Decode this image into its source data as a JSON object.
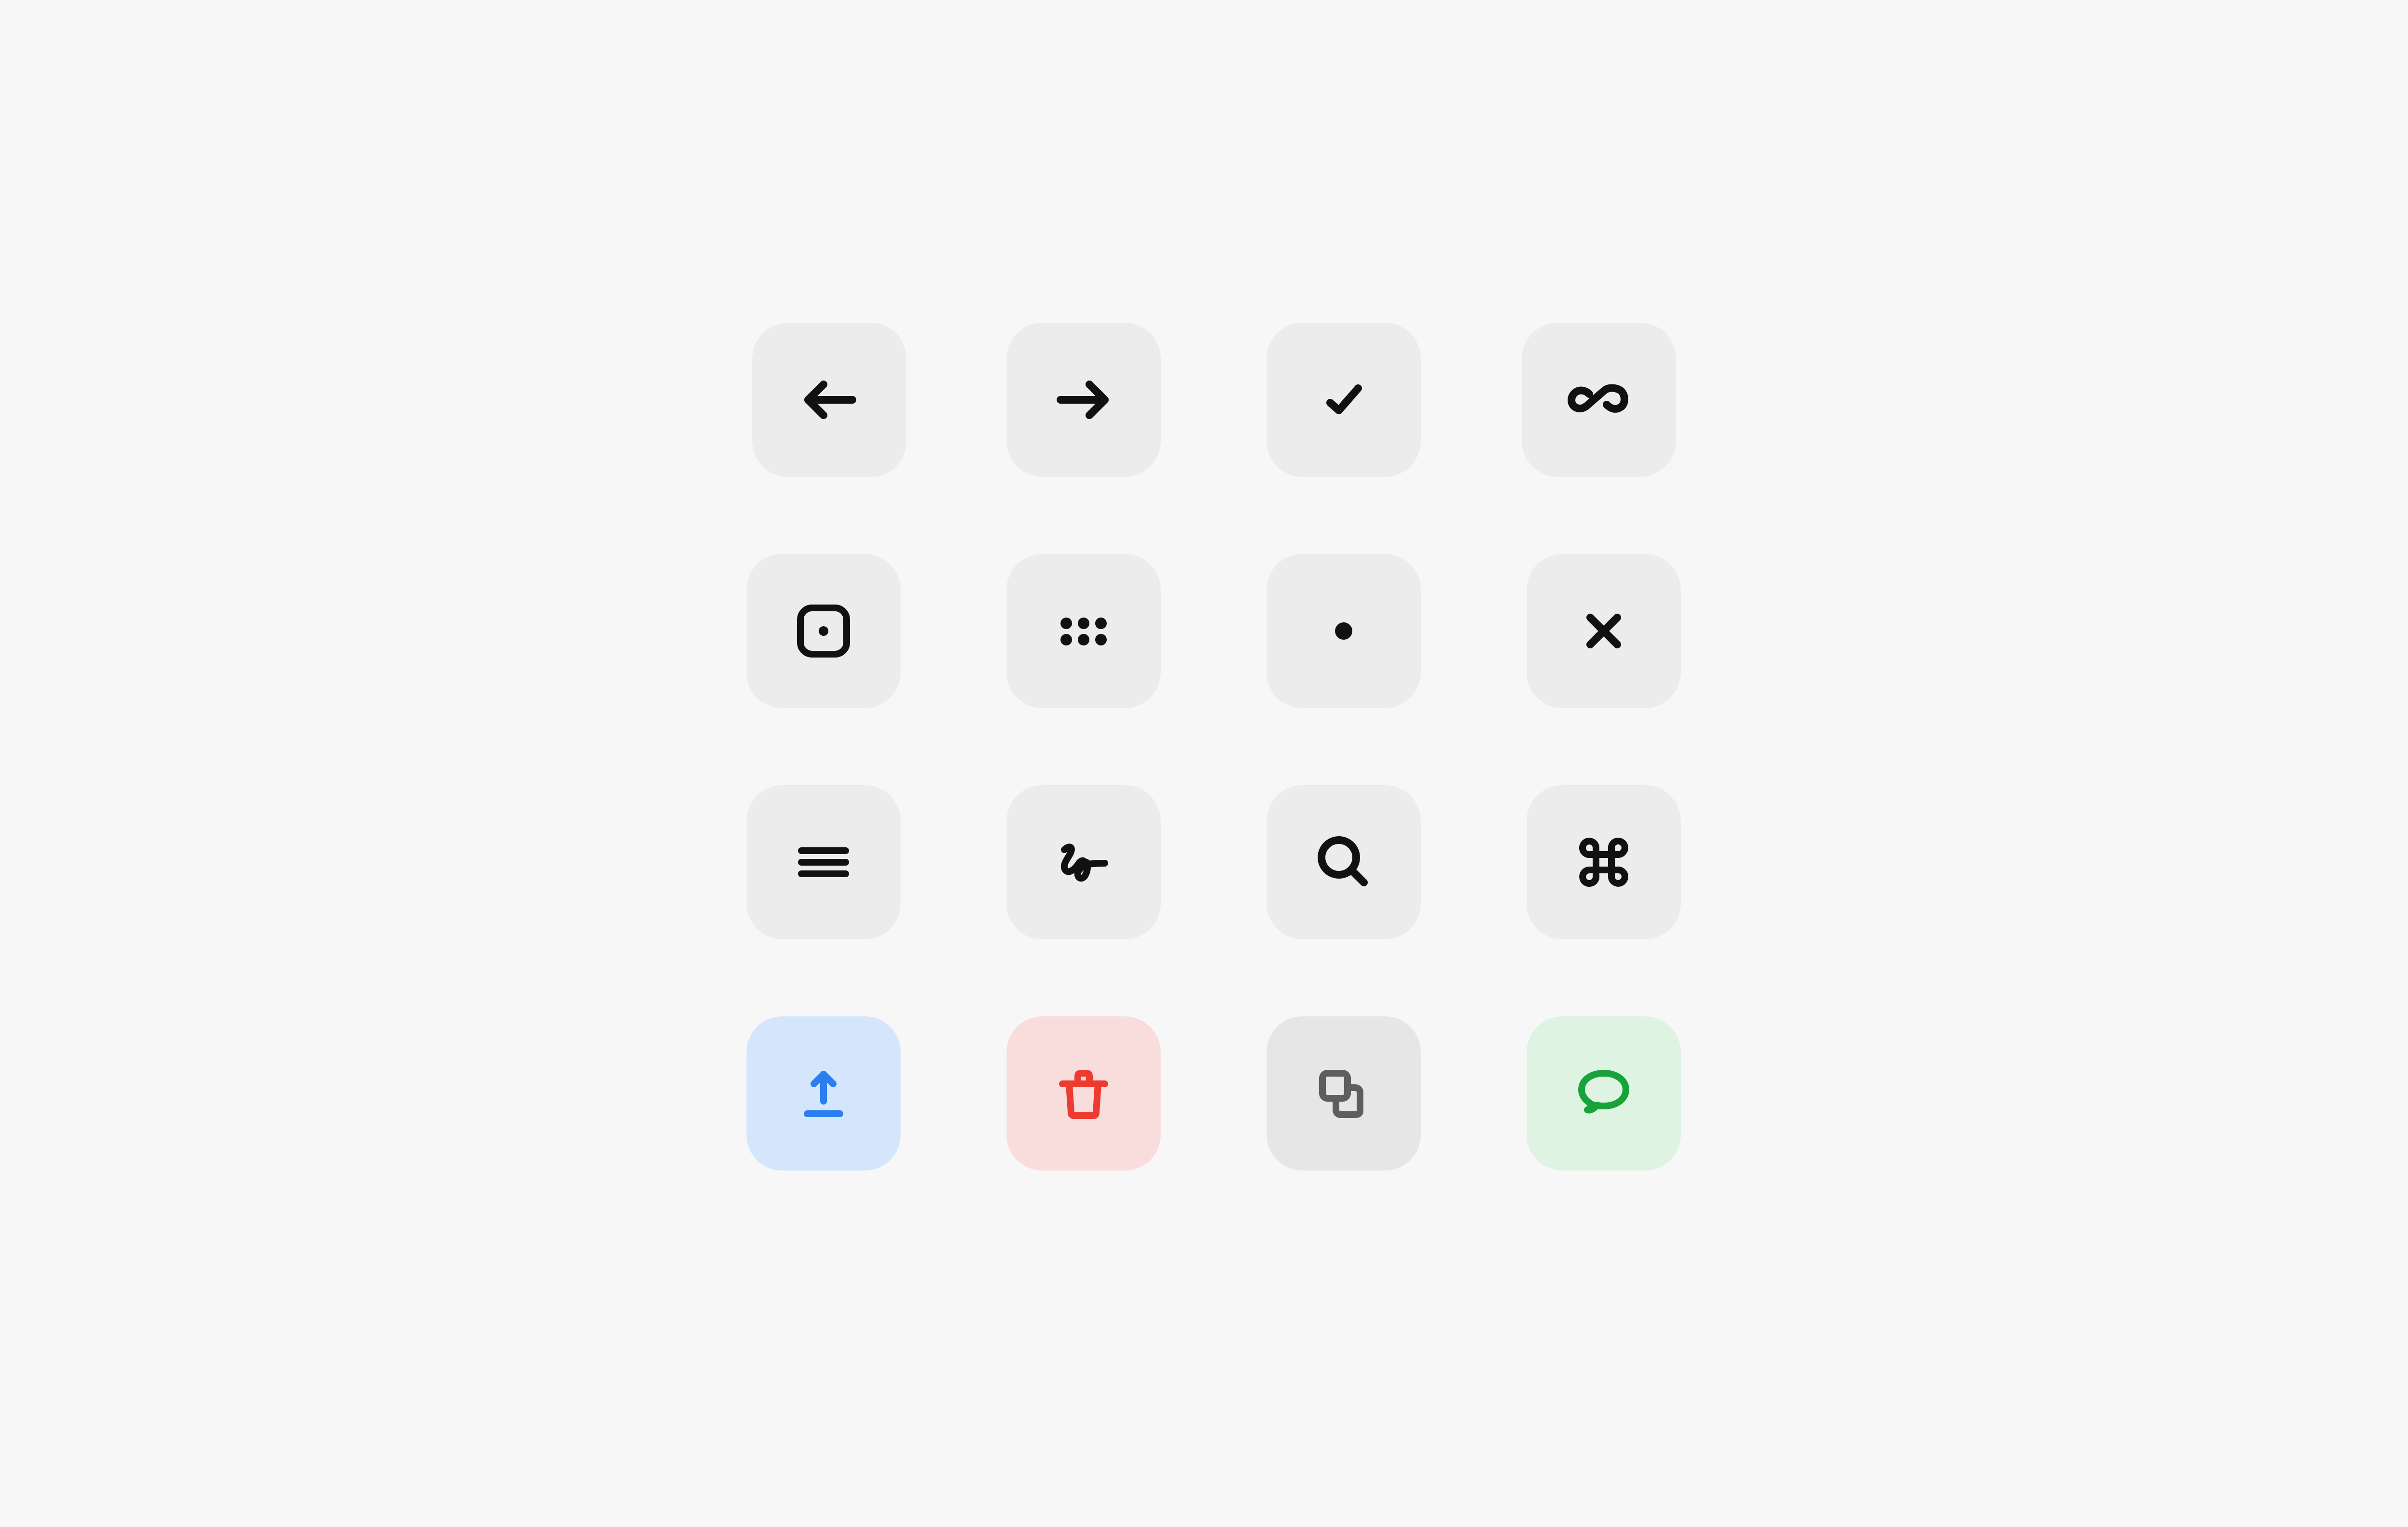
{
  "page": {
    "background": "#f7f7f7"
  },
  "colors": {
    "tile_neutral": "#ececec",
    "tile_blue": "#d3e6fb",
    "tile_red": "#f9dcdc",
    "tile_gray": "#e6e6e6",
    "tile_green": "#dff3e3",
    "icon_black": "#111111",
    "icon_blue": "#2c7ef0",
    "icon_red": "#ee3b30",
    "icon_gray": "#5e5e5e",
    "icon_green": "#17a33a"
  },
  "icon_grid": {
    "rows": [
      [
        {
          "icon": "arrow-left-icon",
          "variant": "neutral"
        },
        {
          "icon": "arrow-right-icon",
          "variant": "neutral"
        },
        {
          "icon": "checkmark-icon",
          "variant": "neutral"
        },
        {
          "icon": "infinity-link-icon",
          "variant": "neutral"
        }
      ],
      [
        {
          "icon": "square-dot-icon",
          "variant": "neutral"
        },
        {
          "icon": "six-dots-icon",
          "variant": "neutral"
        },
        {
          "icon": "dot-icon",
          "variant": "neutral"
        },
        {
          "icon": "close-icon",
          "variant": "neutral"
        }
      ],
      [
        {
          "icon": "menu-lines-icon",
          "variant": "neutral"
        },
        {
          "icon": "signature-icon",
          "variant": "neutral"
        },
        {
          "icon": "search-icon",
          "variant": "neutral"
        },
        {
          "icon": "command-key-icon",
          "variant": "neutral"
        }
      ],
      [
        {
          "icon": "upload-icon",
          "variant": "blue"
        },
        {
          "icon": "trash-icon",
          "variant": "red"
        },
        {
          "icon": "duplicate-icon",
          "variant": "gray"
        },
        {
          "icon": "chat-bubble-icon",
          "variant": "green"
        }
      ]
    ]
  }
}
